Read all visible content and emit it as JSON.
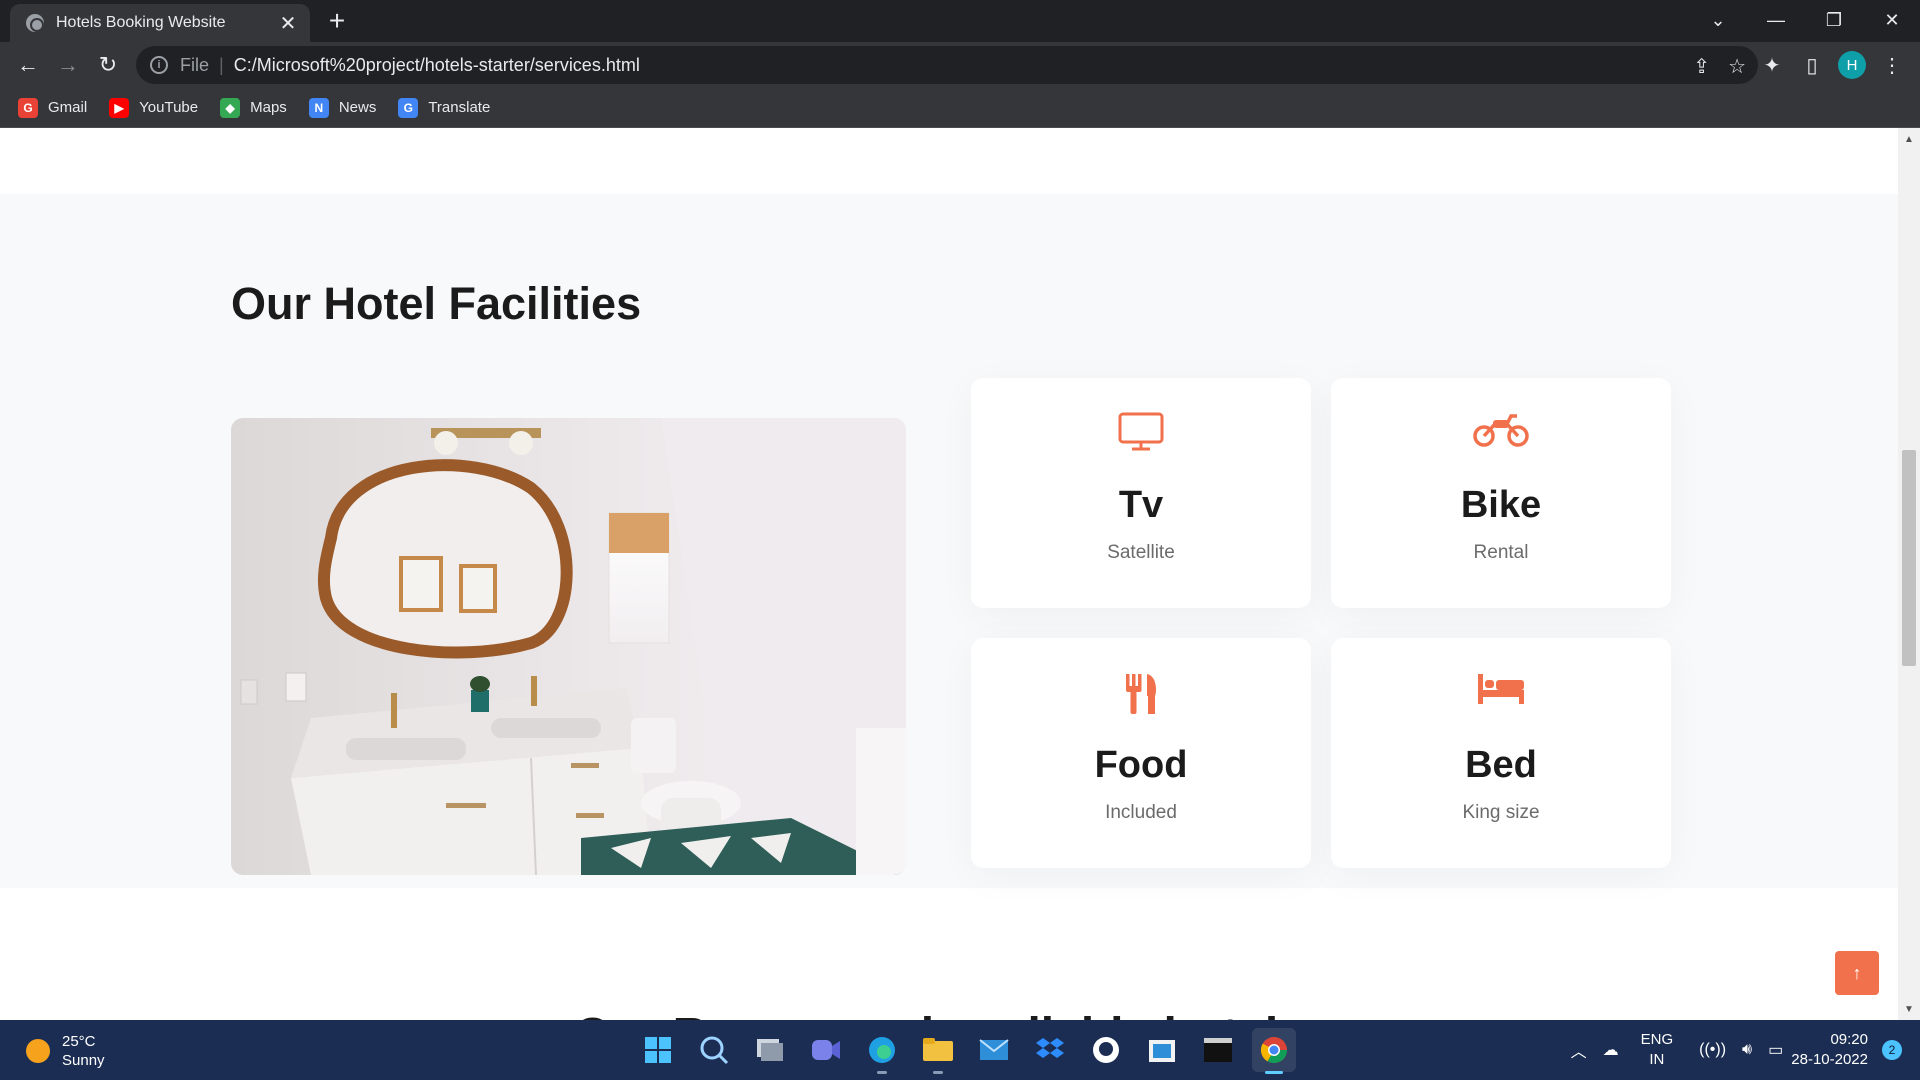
{
  "browser": {
    "tab_title": "Hotels Booking Website",
    "tab_close": "✕",
    "new_tab": "+",
    "scheme": "File",
    "url": "C:/Microsoft%20project/hotels-starter/services.html",
    "profile_initial": "H"
  },
  "bookmarks": [
    {
      "label": "Gmail",
      "icon": "gmail-icon",
      "color": "#ea4335",
      "glyph": "G"
    },
    {
      "label": "YouTube",
      "icon": "youtube-icon",
      "color": "#ff0000",
      "glyph": "▶"
    },
    {
      "label": "Maps",
      "icon": "maps-icon",
      "color": "#34a853",
      "glyph": "◆"
    },
    {
      "label": "News",
      "icon": "news-icon",
      "color": "#4285f4",
      "glyph": "N"
    },
    {
      "label": "Translate",
      "icon": "translate-icon",
      "color": "#4285f4",
      "glyph": "G"
    }
  ],
  "page": {
    "section_title": "Our Hotel Facilities",
    "accent_color": "#f0714b",
    "facilities": [
      {
        "title": "Tv",
        "subtitle": "Satellite",
        "icon": "tv-icon"
      },
      {
        "title": "Bike",
        "subtitle": "Rental",
        "icon": "motorcycle-icon"
      },
      {
        "title": "Food",
        "subtitle": "Included",
        "icon": "utensils-icon"
      },
      {
        "title": "Bed",
        "subtitle": "King size",
        "icon": "bed-icon"
      }
    ],
    "next_section_title_partial": "Our Rooms and available hotels",
    "back_to_top": "↑"
  },
  "taskbar": {
    "temperature": "25°C",
    "condition": "Sunny",
    "lang_line1": "ENG",
    "lang_line2": "IN",
    "time": "09:20",
    "date": "28-10-2022",
    "notifications": "2"
  }
}
